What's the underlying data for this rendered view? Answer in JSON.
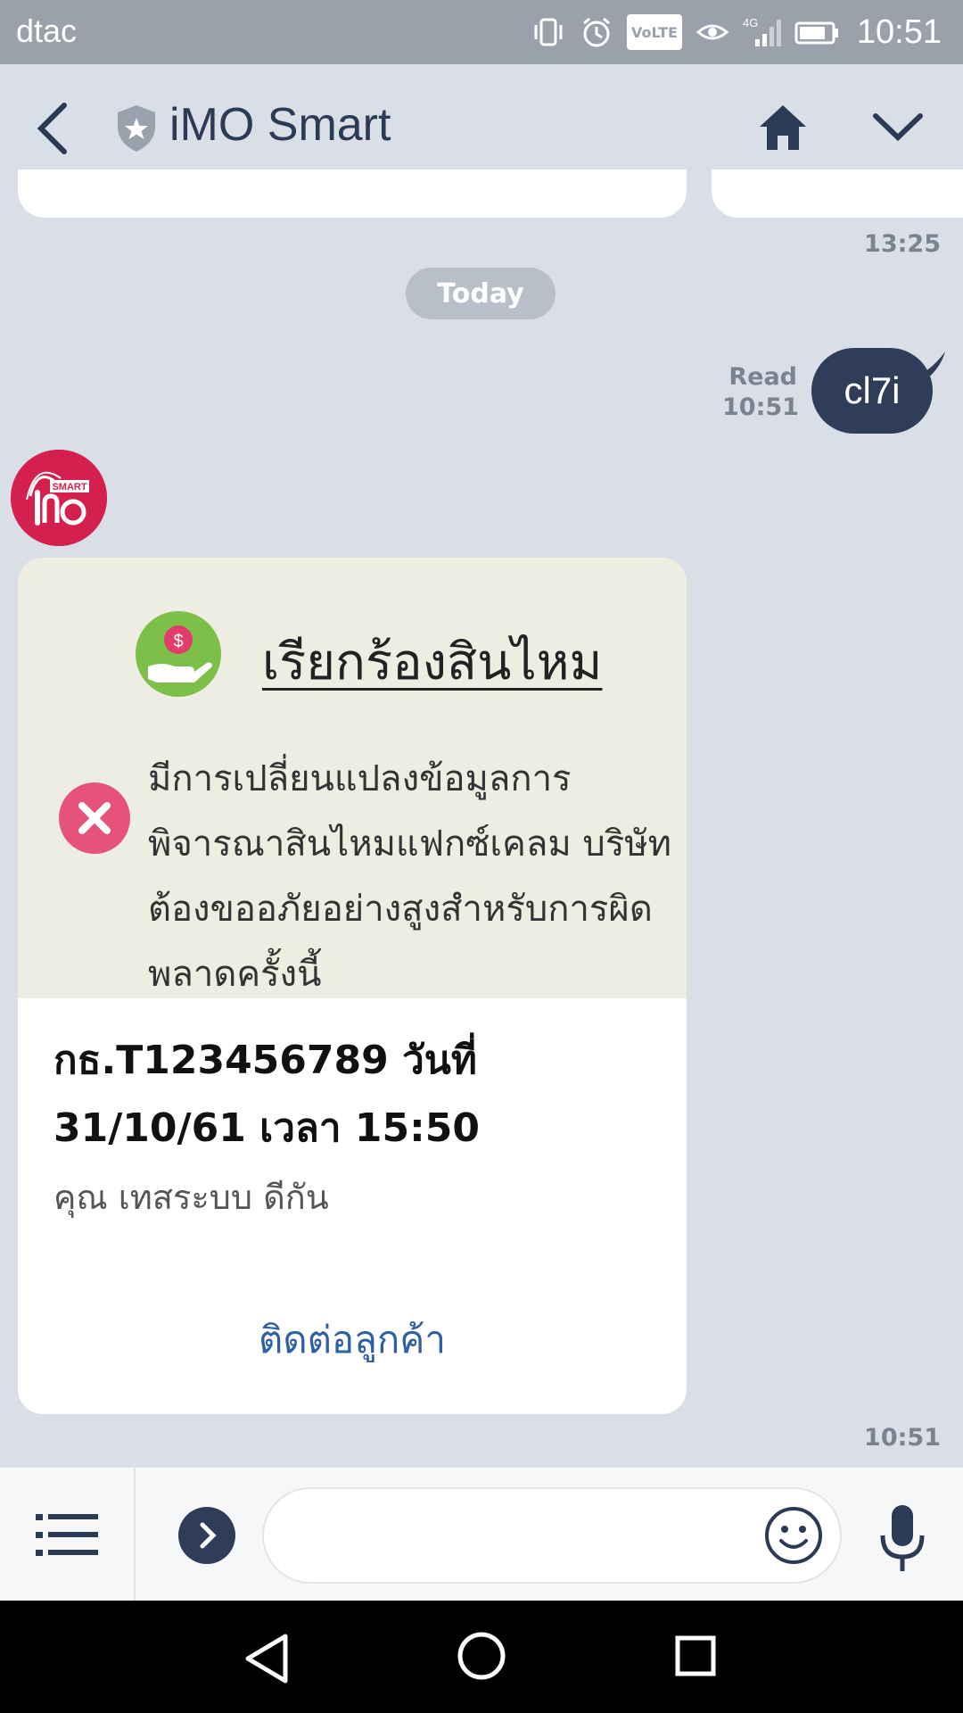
{
  "status_bar": {
    "carrier": "dtac",
    "network": "4G",
    "network_icon_text": "VoLTE",
    "time": "10:51"
  },
  "header": {
    "title": "iMO Smart"
  },
  "chat": {
    "prev_time": "13:25",
    "date_divider": "Today",
    "my_message": {
      "text": "cl7i",
      "read_label": "Read",
      "read_time": "10:51"
    },
    "bot_message": {
      "avatar_text": "SMART",
      "card": {
        "hero_title": "เรียกร้องสินไหม",
        "hero_message": "มีการเปลี่ยนแปลงข้อมูลการพิจารณาสินไหมแฟกซ์เคลม บริษัทต้องขออภัยอย่างสูงสำหรับการผิดพลาดครั้งนี้",
        "ref_line": "กธ.T123456789 วันที่ 31/10/61 เวลา 15:50",
        "customer": "คุณ เทสระบบ ดีกัน",
        "action_label": "ติดต่อลูกค้า"
      },
      "time": "10:51"
    }
  },
  "input_bar": {
    "placeholder": ""
  },
  "colors": {
    "background": "#d9dee7",
    "bubble": "#2f3d58",
    "link": "#2f5fa5",
    "avatar": "#d4204e",
    "hero_bg": "#eeede2"
  }
}
